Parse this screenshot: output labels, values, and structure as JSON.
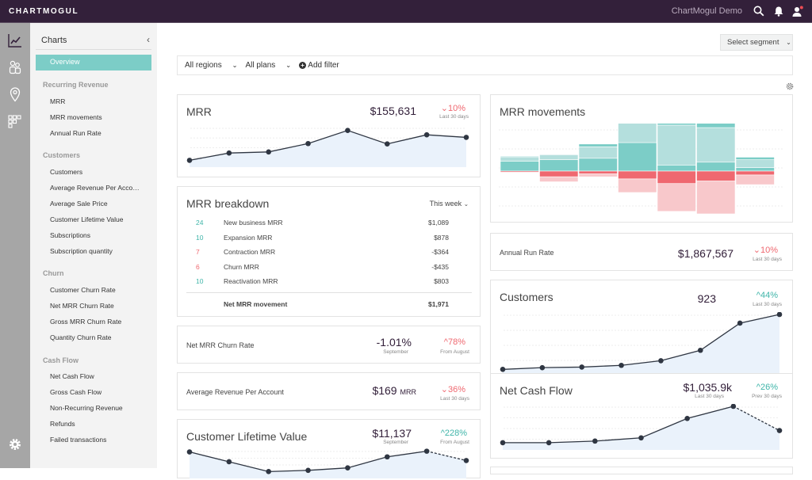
{
  "topbar": {
    "logo": "CHARTMOGUL",
    "account": "ChartMogul Demo",
    "icons": [
      "search-icon",
      "bell-icon",
      "user-icon"
    ]
  },
  "rail": {
    "icons": [
      "line-chart-icon",
      "people-icon",
      "location-pin-icon",
      "grid-icon",
      "gear-icon"
    ]
  },
  "sidebar": {
    "title": "Charts",
    "active": "Overview",
    "sections": [
      {
        "label": "Recurring Revenue",
        "items": [
          "MRR",
          "MRR movements",
          "Annual Run Rate"
        ]
      },
      {
        "label": "Customers",
        "items": [
          "Customers",
          "Average Revenue Per Acco…",
          "Average Sale Price",
          "Customer Lifetime Value",
          "Subscriptions",
          "Subscription quantity"
        ]
      },
      {
        "label": "Churn",
        "items": [
          "Customer Churn Rate",
          "Net MRR Churn Rate",
          "Gross MRR Churn Rate",
          "Quantity Churn Rate"
        ]
      },
      {
        "label": "Cash Flow",
        "items": [
          "Net Cash Flow",
          "Gross Cash Flow",
          "Non-Recurring Revenue",
          "Refunds",
          "Failed transactions"
        ]
      }
    ]
  },
  "toolbar": {
    "segment": "Select segment",
    "regions": "All regions",
    "plans": "All plans",
    "add_filter": "Add filter"
  },
  "cards": {
    "mrr": {
      "title": "MRR",
      "value": "$155,631",
      "change": "10%",
      "direction": "down",
      "period": "Last 30 days",
      "points": [
        0.1,
        0.3,
        0.33,
        0.56,
        0.92,
        0.55,
        0.8,
        0.73
      ]
    },
    "breakdown": {
      "title": "MRR breakdown",
      "period": "This week",
      "rows": [
        {
          "count": "24",
          "label": "New business MRR",
          "value": "$1,089",
          "tone": "up"
        },
        {
          "count": "10",
          "label": "Expansion MRR",
          "value": "$878",
          "tone": "up"
        },
        {
          "count": "7",
          "label": "Contraction MRR",
          "value": "-$364",
          "tone": "down"
        },
        {
          "count": "6",
          "label": "Churn MRR",
          "value": "-$435",
          "tone": "down"
        },
        {
          "count": "10",
          "label": "Reactivation MRR",
          "value": "$803",
          "tone": "up"
        }
      ],
      "total_label": "Net MRR movement",
      "total_value": "$1,971"
    },
    "net_churn": {
      "title": "Net MRR Churn Rate",
      "value": "-1.01%",
      "sub": "September",
      "change": "78%",
      "direction": "up",
      "period": "From August"
    },
    "arpa": {
      "title": "Average Revenue Per Account",
      "value": "$169",
      "unit": "MRR",
      "change": "36%",
      "direction": "down",
      "period": "Last 30 days"
    },
    "ltv": {
      "title": "Customer Lifetime Value",
      "value": "$11,137",
      "sub": "September",
      "change": "228%",
      "direction": "up",
      "period": "From August",
      "points": [
        0.95,
        0.55,
        0.15,
        0.2,
        0.3,
        0.75,
        0.98,
        0.6
      ]
    },
    "movements": {
      "title": "MRR movements",
      "bars": [
        {
          "new": 0.28,
          "expansion": 0.12,
          "contraction": -0.03,
          "churn": -0.02
        },
        {
          "new": 0.32,
          "expansion": 0.14,
          "contraction": -0.16,
          "churn": -0.14
        },
        {
          "new": 0.36,
          "expansion": 0.32,
          "contraction": -0.08,
          "churn": -0.08
        },
        {
          "new": 0.8,
          "expansion": 0.6,
          "contraction": -0.22,
          "churn": -0.38
        },
        {
          "new": 0.17,
          "expansion": 1.12,
          "contraction": -0.35,
          "churn": -0.78
        },
        {
          "new": 0.25,
          "expansion": 0.97,
          "contraction": -0.28,
          "churn": -0.92
        },
        {
          "new": 0.1,
          "expansion": 0.22,
          "contraction": -0.11,
          "churn": -0.27
        }
      ],
      "reactivation": [
        0.02,
        0.01,
        0.08,
        0.04,
        0.17,
        0.25,
        0.07
      ]
    },
    "arr": {
      "title": "Annual Run Rate",
      "value": "$1,867,567",
      "change": "10%",
      "direction": "down",
      "period": "Last 30 days"
    },
    "customers": {
      "title": "Customers",
      "value": "923",
      "change": "44%",
      "direction": "up",
      "period": "Last 30 days",
      "points": [
        0.05,
        0.08,
        0.09,
        0.12,
        0.2,
        0.38,
        0.85,
        1.0
      ]
    },
    "cashflow": {
      "title": "Net Cash Flow",
      "value": "$1,035.9k",
      "sub": "Last 30 days",
      "change": "26%",
      "direction": "up",
      "period": "Prev 30 days",
      "points": [
        0.1,
        0.1,
        0.14,
        0.22,
        0.7,
        1.0,
        0.4
      ]
    }
  }
}
